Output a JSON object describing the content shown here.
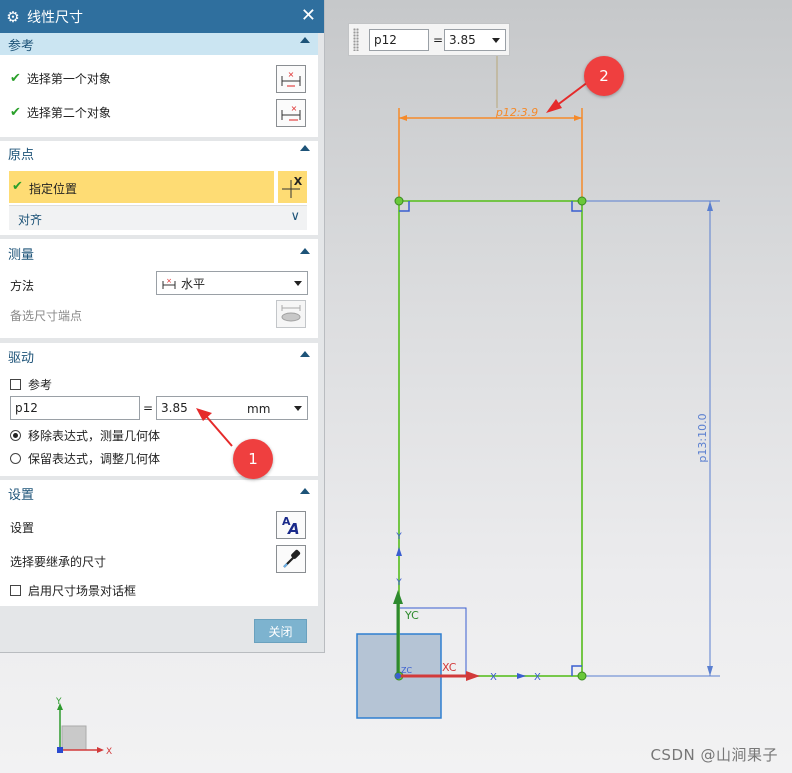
{
  "dialog": {
    "title": "线性尺寸",
    "close_glyph": "✕",
    "sections": {
      "reference": {
        "title": "参考",
        "first_object": "选择第一个对象",
        "second_object": "选择第二个对象"
      },
      "origin": {
        "title": "原点",
        "specify_location": "指定位置",
        "align": "对齐"
      },
      "measure": {
        "title": "测量",
        "method_label": "方法",
        "method_value": "水平",
        "alt_endpoint": "备选尺寸端点"
      },
      "drive": {
        "title": "驱动",
        "reference_label": "参考",
        "reference_checked": false,
        "expr_name": "p12",
        "equals": "=",
        "expr_value": "3.85",
        "unit": "mm",
        "option_remove": "移除表达式，测量几何体",
        "option_keep": "保留表达式，调整几何体",
        "selected_option": "remove"
      },
      "settings": {
        "title": "设置",
        "settings_label": "设置",
        "inherit_label": "选择要继承的尺寸",
        "enable_dialog": "启用尺寸场景对话框",
        "enable_checked": false
      }
    },
    "close_button": "关闭"
  },
  "float_toolbar": {
    "name_value": "p12",
    "equals": "=",
    "value": "3.85"
  },
  "canvas": {
    "horizontal_dim": "p12:3.9",
    "vertical_dim": "p13:10.0",
    "yc_label": "YC",
    "xc_label": "XC",
    "zc_label": "ZC",
    "y_label": "Y",
    "x_label": "X",
    "axis_y": "Y",
    "axis_x": "X"
  },
  "callouts": {
    "one": "1",
    "two": "2"
  },
  "watermark": "CSDN @山涧果子",
  "colors": {
    "title_bar": "#2f6f9e",
    "section_header": "#cbe5f2",
    "highlight_row": "#fedc74",
    "sketch_green": "#66c233",
    "dimension_orange": "#f58a2a",
    "dimension_blue": "#5a7fd0",
    "callout_red": "#ef3f3f"
  }
}
